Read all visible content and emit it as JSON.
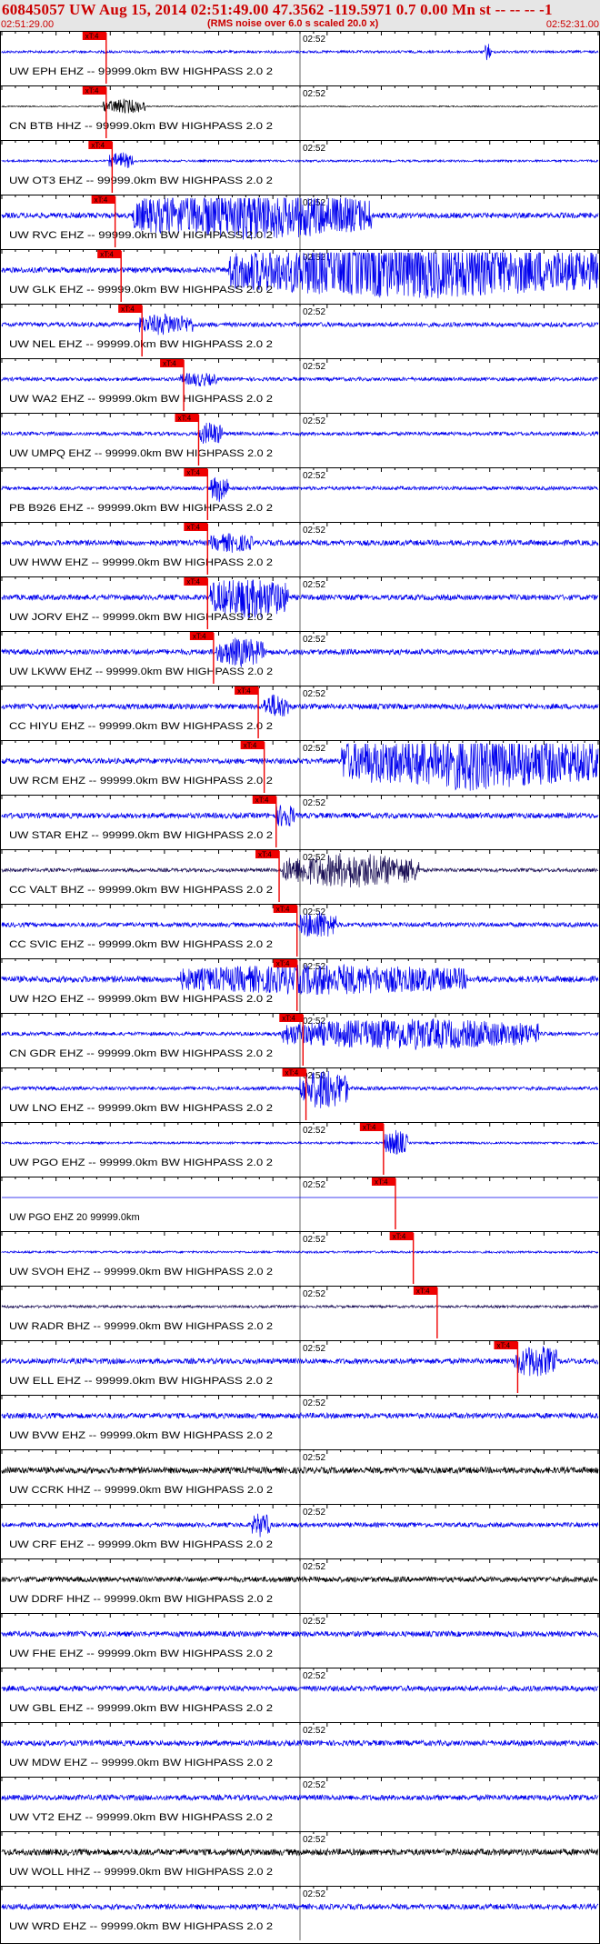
{
  "header": {
    "title": "60845057 UW Aug 15, 2014 02:51:49.00   47.3562 -119.5971  0.7 0.00 Mn st -- -- --  -1",
    "subtitle": "(RMS noise over 6.0 s scaled 20.0 x)",
    "time_start": "02:51:29.00",
    "time_end": "02:52:31.00"
  },
  "colors": {
    "trace_blue": "#0000ee",
    "trace_black": "#000000",
    "trace_dark": "#1a0f55",
    "pick_red": "#ee0000",
    "header_bg": "#e6e6e6"
  },
  "chart_data": {
    "type": "seismogram",
    "time_start": "02:51:29.00",
    "time_end": "02:52:31.00",
    "mid_tick_label": "02:52",
    "pick_label": "xT:4",
    "traces": [
      {
        "label": "UW EPH EHZ -- 99999.0km BW  HIGHPASS  2.0  2",
        "color": "blue",
        "pick": 0.175,
        "burst": [
          0.81,
          0.82,
          1.0
        ],
        "amp": 0.14
      },
      {
        "label": "CN BTB HHZ -- 99999.0km BW  HIGHPASS  2.0  2",
        "color": "black",
        "pick": 0.175,
        "burst": [
          0.17,
          0.24,
          0.8
        ],
        "amp": 0.06
      },
      {
        "label": "UW OT3 EHZ -- 99999.0km BW  HIGHPASS  2.0  2",
        "color": "blue",
        "pick": 0.185,
        "burst": [
          0.18,
          0.22,
          0.9
        ],
        "amp": 0.12
      },
      {
        "label": "UW RVC EHZ -- 99999.0km BW  HIGHPASS  2.0  2",
        "color": "blue",
        "pick": 0.19,
        "burst": [
          0.22,
          0.62,
          2.5
        ],
        "amp": 0.3
      },
      {
        "label": "UW GLK EHZ -- 99999.0km BW  HIGHPASS  2.0  2",
        "color": "blue",
        "pick": 0.2,
        "burst": [
          0.38,
          1.0,
          3.0
        ],
        "amp": 0.3
      },
      {
        "label": "UW NEL EHZ -- 99999.0km BW  HIGHPASS  2.0  2",
        "color": "blue",
        "pick": 0.235,
        "burst": [
          0.23,
          0.32,
          1.0
        ],
        "amp": 0.25
      },
      {
        "label": "UW WA2 EHZ -- 99999.0km BW  HIGHPASS  2.0  2",
        "color": "blue",
        "pick": 0.305,
        "burst": [
          0.3,
          0.36,
          0.6
        ],
        "amp": 0.2
      },
      {
        "label": "UW UMPQ EHZ -- 99999.0km BW  HIGHPASS  2.0  2",
        "color": "blue",
        "pick": 0.33,
        "burst": [
          0.33,
          0.37,
          1.2
        ],
        "amp": 0.2
      },
      {
        "label": "PB B926 EHZ -- 99999.0km BW  HIGHPASS  2.0  2",
        "color": "blue",
        "pick": 0.345,
        "burst": [
          0.35,
          0.38,
          1.4
        ],
        "amp": 0.2
      },
      {
        "label": "UW HWW EHZ -- 99999.0km BW  HIGHPASS  2.0  2",
        "color": "blue",
        "pick": 0.345,
        "burst": [
          0.35,
          0.42,
          0.8
        ],
        "amp": 0.3
      },
      {
        "label": "UW JORV EHZ -- 99999.0km BW  HIGHPASS  2.0  2",
        "color": "blue",
        "pick": 0.345,
        "burst": [
          0.35,
          0.48,
          2.2
        ],
        "amp": 0.3
      },
      {
        "label": "UW LKWW EHZ -- 99999.0km BW  HIGHPASS  2.0  2",
        "color": "blue",
        "pick": 0.355,
        "burst": [
          0.36,
          0.44,
          1.4
        ],
        "amp": 0.3
      },
      {
        "label": "CC HIYU EHZ -- 99999.0km BW  HIGHPASS  2.0  2",
        "color": "blue",
        "pick": 0.43,
        "burst": [
          0.44,
          0.48,
          1.2
        ],
        "amp": 0.3
      },
      {
        "label": "UW RCM EHZ -- 99999.0km BW  HIGHPASS  2.0  2",
        "color": "blue",
        "pick": 0.44,
        "burst": [
          0.57,
          1.0,
          3.0
        ],
        "amp": 0.3
      },
      {
        "label": "UW STAR EHZ -- 99999.0km BW  HIGHPASS  2.0  2",
        "color": "blue",
        "pick": 0.46,
        "burst": [
          0.46,
          0.49,
          1.2
        ],
        "amp": 0.3
      },
      {
        "label": "CC VALT BHZ -- 99999.0km BW  HIGHPASS  2.0  2",
        "color": "dark",
        "pick": 0.465,
        "burst": [
          0.47,
          0.7,
          1.8
        ],
        "amp": 0.2
      },
      {
        "label": "CC SVIC EHZ -- 99999.0km BW  HIGHPASS  2.0  2",
        "color": "blue",
        "pick": 0.495,
        "burst": [
          0.5,
          0.56,
          1.4
        ],
        "amp": 0.25
      },
      {
        "label": "UW H2O EHZ -- 99999.0km BW  HIGHPASS  2.0  2",
        "color": "blue",
        "pick": 0.495,
        "burst": [
          0.3,
          0.78,
          1.4
        ],
        "amp": 0.35
      },
      {
        "label": "CN GDR EHZ -- 99999.0km BW  HIGHPASS  2.0  2",
        "color": "blue",
        "pick": 0.505,
        "burst": [
          0.47,
          0.9,
          1.6
        ],
        "amp": 0.2
      },
      {
        "label": "UW LNO EHZ -- 99999.0km BW  HIGHPASS  2.0  2",
        "color": "blue",
        "pick": 0.51,
        "burst": [
          0.5,
          0.58,
          2.2
        ],
        "amp": 0.2
      },
      {
        "label": "UW PGO EHZ -- 99999.0km BW  HIGHPASS  2.0  2",
        "color": "blue",
        "pick": 0.64,
        "burst": [
          0.64,
          0.68,
          1.4
        ],
        "amp": 0.12
      },
      {
        "label": "UW PGO EHZ 20 99999.0km",
        "color": "blue",
        "pick": 0.66,
        "burst": null,
        "amp": 0.0
      },
      {
        "label": "UW SVOH EHZ -- 99999.0km BW  HIGHPASS  2.0  2",
        "color": "blue",
        "pick": 0.69,
        "burst": null,
        "amp": 0.12
      },
      {
        "label": "UW RADR BHZ -- 99999.0km BW  HIGHPASS  2.0  2",
        "color": "dark",
        "pick": 0.73,
        "burst": null,
        "amp": 0.14
      },
      {
        "label": "UW ELL EHZ -- 99999.0km BW  HIGHPASS  2.0  2",
        "color": "blue",
        "pick": 0.865,
        "burst": [
          0.86,
          0.93,
          1.6
        ],
        "amp": 0.3
      },
      {
        "label": "UW BVW EHZ -- 99999.0km BW  HIGHPASS  2.0  2",
        "color": "blue",
        "pick": null,
        "burst": null,
        "amp": 0.3
      },
      {
        "label": "UW CCRK HHZ -- 99999.0km BW  HIGHPASS  2.0  2",
        "color": "black",
        "pick": null,
        "burst": null,
        "amp": 0.35
      },
      {
        "label": "UW CRF EHZ -- 99999.0km BW  HIGHPASS  2.0  2",
        "color": "blue",
        "pick": null,
        "burst": [
          0.42,
          0.45,
          1.2
        ],
        "amp": 0.25
      },
      {
        "label": "UW DDRF HHZ -- 99999.0km BW  HIGHPASS  2.0  2",
        "color": "black",
        "pick": null,
        "burst": null,
        "amp": 0.3
      },
      {
        "label": "UW FHE EHZ -- 99999.0km BW  HIGHPASS  2.0  2",
        "color": "blue",
        "pick": null,
        "burst": null,
        "amp": 0.3
      },
      {
        "label": "UW GBL EHZ -- 99999.0km BW  HIGHPASS  2.0  2",
        "color": "blue",
        "pick": null,
        "burst": null,
        "amp": 0.3
      },
      {
        "label": "UW MDW EHZ -- 99999.0km BW  HIGHPASS  2.0  2",
        "color": "blue",
        "pick": null,
        "burst": null,
        "amp": 0.3
      },
      {
        "label": "UW VT2 EHZ -- 99999.0km BW  HIGHPASS  2.0  2",
        "color": "blue",
        "pick": null,
        "burst": null,
        "amp": 0.3
      },
      {
        "label": "UW WOLL HHZ -- 99999.0km BW  HIGHPASS  2.0  2",
        "color": "black",
        "pick": null,
        "burst": null,
        "amp": 0.35
      },
      {
        "label": "UW WRD EHZ -- 99999.0km BW  HIGHPASS  2.0  2",
        "color": "blue",
        "pick": null,
        "burst": null,
        "amp": 0.3
      }
    ]
  }
}
